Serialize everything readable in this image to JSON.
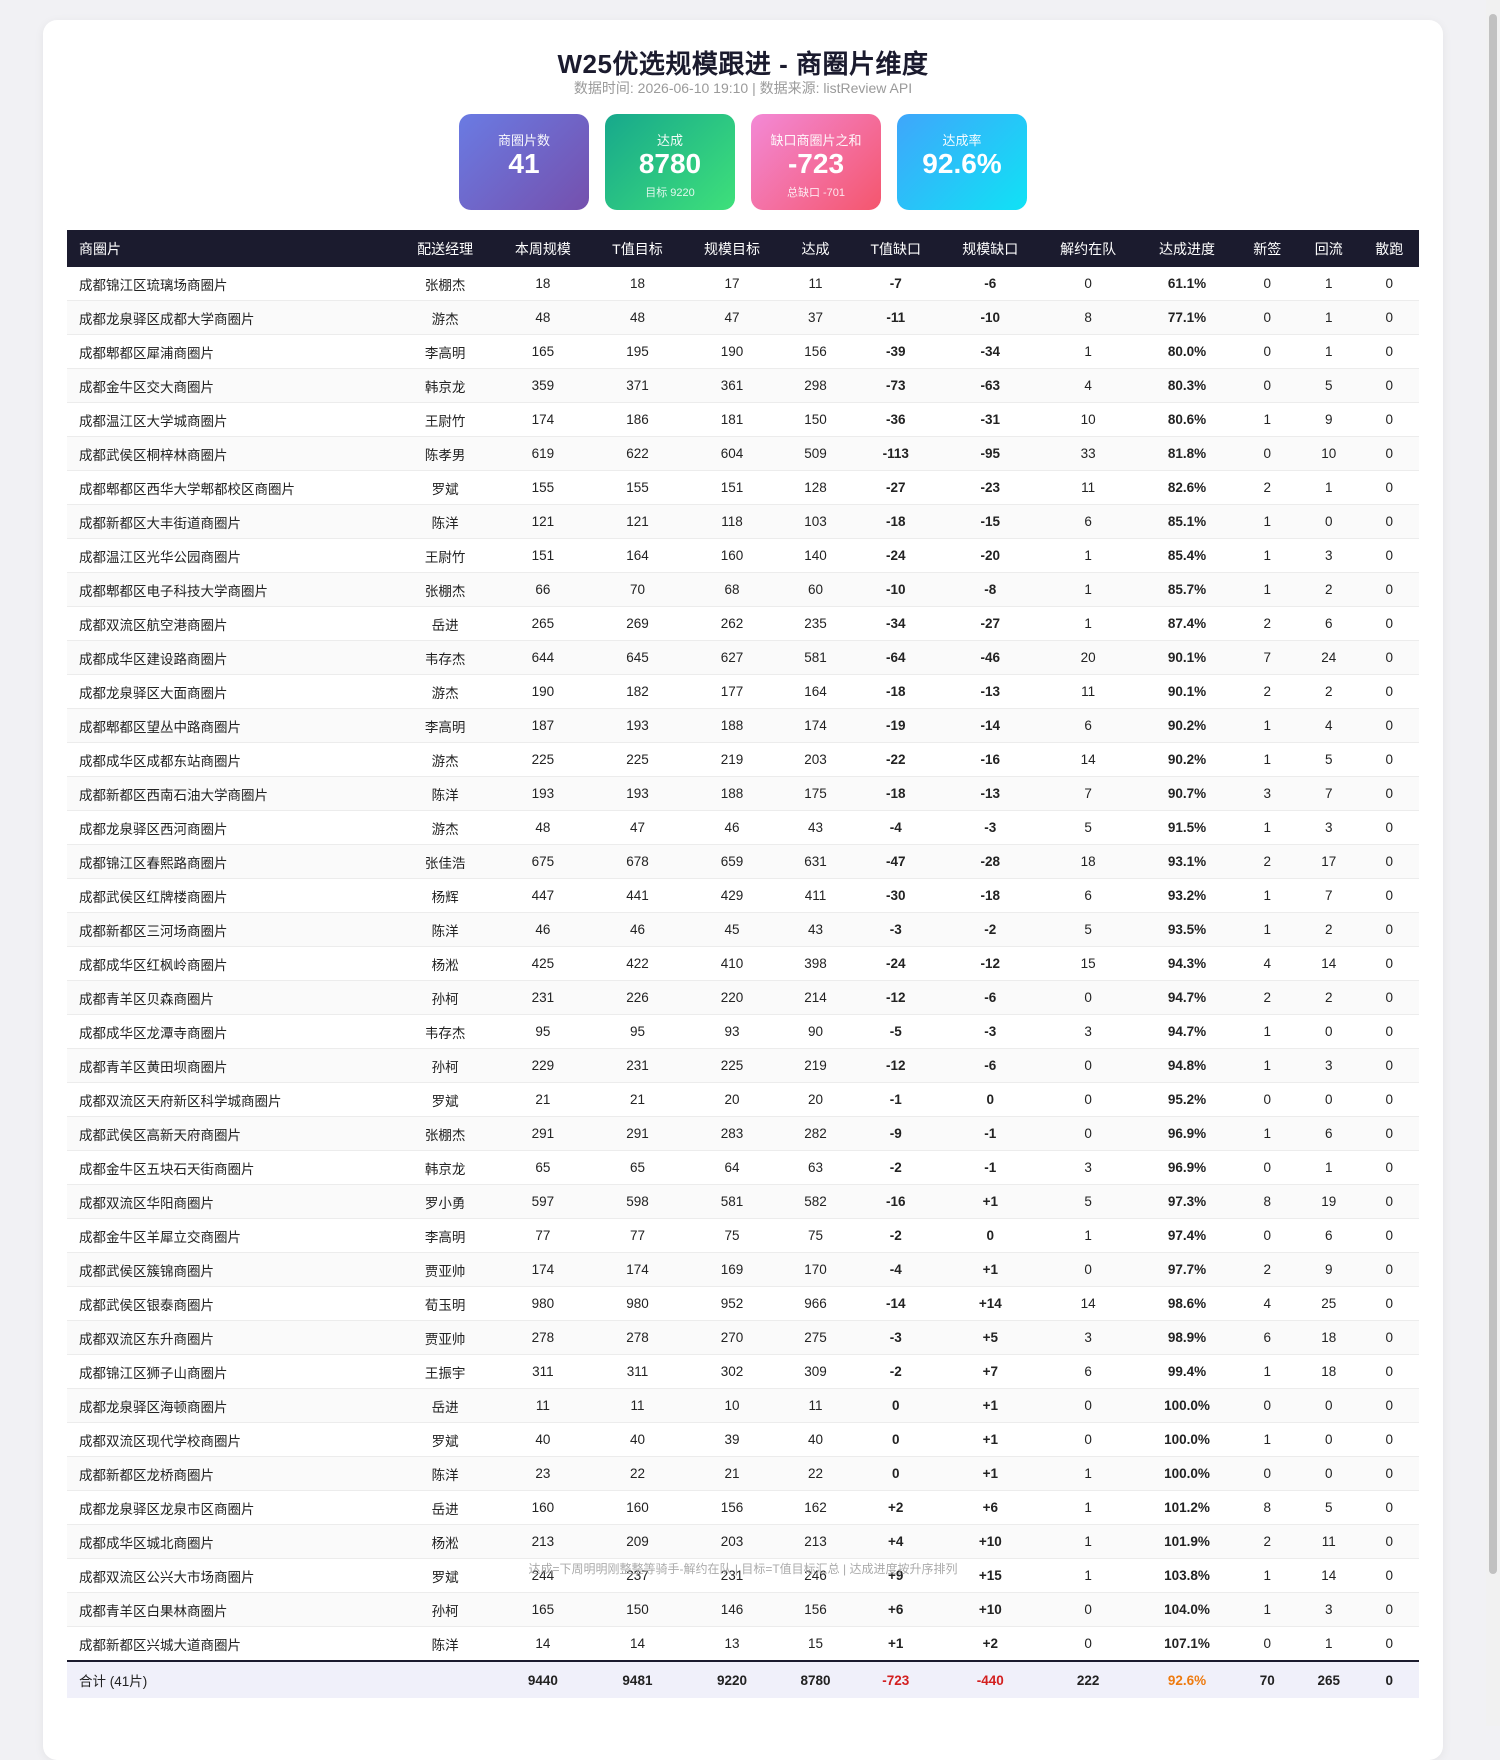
{
  "header": {
    "title": "W25优选规模跟进 - 商圈片维度",
    "subtitle": "数据时间: 2026-06-10 19:10 | 数据来源: listReview API"
  },
  "kpis": [
    {
      "label": "商圈片数",
      "value": "41",
      "sub": ""
    },
    {
      "label": "达成",
      "value": "8780",
      "sub": "目标 9220"
    },
    {
      "label": "缺口商圈片之和",
      "value": "-723",
      "sub": "总缺口 -701"
    },
    {
      "label": "达成率",
      "value": "92.6%",
      "sub": ""
    }
  ],
  "table": {
    "columns": [
      "商圈片",
      "配送经理",
      "本周规模",
      "T值目标",
      "规模目标",
      "达成",
      "T值缺口",
      "规模缺口",
      "解约在队",
      "达成进度",
      "新签",
      "回流",
      "散跑"
    ],
    "rows": [
      [
        "成都锦江区琉璃场商圈片",
        "张棚杰",
        "18",
        "18",
        "17",
        "11",
        "-7",
        "-6",
        "0",
        "61.1%",
        "0",
        "1",
        "0"
      ],
      [
        "成都龙泉驿区成都大学商圈片",
        "游杰",
        "48",
        "48",
        "47",
        "37",
        "-11",
        "-10",
        "8",
        "77.1%",
        "0",
        "1",
        "0"
      ],
      [
        "成都郫都区犀浦商圈片",
        "李高明",
        "165",
        "195",
        "190",
        "156",
        "-39",
        "-34",
        "1",
        "80.0%",
        "0",
        "1",
        "0"
      ],
      [
        "成都金牛区交大商圈片",
        "韩京龙",
        "359",
        "371",
        "361",
        "298",
        "-73",
        "-63",
        "4",
        "80.3%",
        "0",
        "5",
        "0"
      ],
      [
        "成都温江区大学城商圈片",
        "王尉竹",
        "174",
        "186",
        "181",
        "150",
        "-36",
        "-31",
        "10",
        "80.6%",
        "1",
        "9",
        "0"
      ],
      [
        "成都武侯区桐梓林商圈片",
        "陈孝男",
        "619",
        "622",
        "604",
        "509",
        "-113",
        "-95",
        "33",
        "81.8%",
        "0",
        "10",
        "0"
      ],
      [
        "成都郫都区西华大学郫都校区商圈片",
        "罗斌",
        "155",
        "155",
        "151",
        "128",
        "-27",
        "-23",
        "11",
        "82.6%",
        "2",
        "1",
        "0"
      ],
      [
        "成都新都区大丰街道商圈片",
        "陈洋",
        "121",
        "121",
        "118",
        "103",
        "-18",
        "-15",
        "6",
        "85.1%",
        "1",
        "0",
        "0"
      ],
      [
        "成都温江区光华公园商圈片",
        "王尉竹",
        "151",
        "164",
        "160",
        "140",
        "-24",
        "-20",
        "1",
        "85.4%",
        "1",
        "3",
        "0"
      ],
      [
        "成都郫都区电子科技大学商圈片",
        "张棚杰",
        "66",
        "70",
        "68",
        "60",
        "-10",
        "-8",
        "1",
        "85.7%",
        "1",
        "2",
        "0"
      ],
      [
        "成都双流区航空港商圈片",
        "岳进",
        "265",
        "269",
        "262",
        "235",
        "-34",
        "-27",
        "1",
        "87.4%",
        "2",
        "6",
        "0"
      ],
      [
        "成都成华区建设路商圈片",
        "韦存杰",
        "644",
        "645",
        "627",
        "581",
        "-64",
        "-46",
        "20",
        "90.1%",
        "7",
        "24",
        "0"
      ],
      [
        "成都龙泉驿区大面商圈片",
        "游杰",
        "190",
        "182",
        "177",
        "164",
        "-18",
        "-13",
        "11",
        "90.1%",
        "2",
        "2",
        "0"
      ],
      [
        "成都郫都区望丛中路商圈片",
        "李高明",
        "187",
        "193",
        "188",
        "174",
        "-19",
        "-14",
        "6",
        "90.2%",
        "1",
        "4",
        "0"
      ],
      [
        "成都成华区成都东站商圈片",
        "游杰",
        "225",
        "225",
        "219",
        "203",
        "-22",
        "-16",
        "14",
        "90.2%",
        "1",
        "5",
        "0"
      ],
      [
        "成都新都区西南石油大学商圈片",
        "陈洋",
        "193",
        "193",
        "188",
        "175",
        "-18",
        "-13",
        "7",
        "90.7%",
        "3",
        "7",
        "0"
      ],
      [
        "成都龙泉驿区西河商圈片",
        "游杰",
        "48",
        "47",
        "46",
        "43",
        "-4",
        "-3",
        "5",
        "91.5%",
        "1",
        "3",
        "0"
      ],
      [
        "成都锦江区春熙路商圈片",
        "张佳浩",
        "675",
        "678",
        "659",
        "631",
        "-47",
        "-28",
        "18",
        "93.1%",
        "2",
        "17",
        "0"
      ],
      [
        "成都武侯区红牌楼商圈片",
        "杨辉",
        "447",
        "441",
        "429",
        "411",
        "-30",
        "-18",
        "6",
        "93.2%",
        "1",
        "7",
        "0"
      ],
      [
        "成都新都区三河场商圈片",
        "陈洋",
        "46",
        "46",
        "45",
        "43",
        "-3",
        "-2",
        "5",
        "93.5%",
        "1",
        "2",
        "0"
      ],
      [
        "成都成华区红枫岭商圈片",
        "杨淞",
        "425",
        "422",
        "410",
        "398",
        "-24",
        "-12",
        "15",
        "94.3%",
        "4",
        "14",
        "0"
      ],
      [
        "成都青羊区贝森商圈片",
        "孙柯",
        "231",
        "226",
        "220",
        "214",
        "-12",
        "-6",
        "0",
        "94.7%",
        "2",
        "2",
        "0"
      ],
      [
        "成都成华区龙潭寺商圈片",
        "韦存杰",
        "95",
        "95",
        "93",
        "90",
        "-5",
        "-3",
        "3",
        "94.7%",
        "1",
        "0",
        "0"
      ],
      [
        "成都青羊区黄田坝商圈片",
        "孙柯",
        "229",
        "231",
        "225",
        "219",
        "-12",
        "-6",
        "0",
        "94.8%",
        "1",
        "3",
        "0"
      ],
      [
        "成都双流区天府新区科学城商圈片",
        "罗斌",
        "21",
        "21",
        "20",
        "20",
        "-1",
        "0",
        "0",
        "95.2%",
        "0",
        "0",
        "0"
      ],
      [
        "成都武侯区高新天府商圈片",
        "张棚杰",
        "291",
        "291",
        "283",
        "282",
        "-9",
        "-1",
        "0",
        "96.9%",
        "1",
        "6",
        "0"
      ],
      [
        "成都金牛区五块石天街商圈片",
        "韩京龙",
        "65",
        "65",
        "64",
        "63",
        "-2",
        "-1",
        "3",
        "96.9%",
        "0",
        "1",
        "0"
      ],
      [
        "成都双流区华阳商圈片",
        "罗小勇",
        "597",
        "598",
        "581",
        "582",
        "-16",
        "+1",
        "5",
        "97.3%",
        "8",
        "19",
        "0"
      ],
      [
        "成都金牛区羊犀立交商圈片",
        "李高明",
        "77",
        "77",
        "75",
        "75",
        "-2",
        "0",
        "1",
        "97.4%",
        "0",
        "6",
        "0"
      ],
      [
        "成都武侯区簇锦商圈片",
        "贾亚帅",
        "174",
        "174",
        "169",
        "170",
        "-4",
        "+1",
        "0",
        "97.7%",
        "2",
        "9",
        "0"
      ],
      [
        "成都武侯区银泰商圈片",
        "荀玉明",
        "980",
        "980",
        "952",
        "966",
        "-14",
        "+14",
        "14",
        "98.6%",
        "4",
        "25",
        "0"
      ],
      [
        "成都双流区东升商圈片",
        "贾亚帅",
        "278",
        "278",
        "270",
        "275",
        "-3",
        "+5",
        "3",
        "98.9%",
        "6",
        "18",
        "0"
      ],
      [
        "成都锦江区狮子山商圈片",
        "王振宇",
        "311",
        "311",
        "302",
        "309",
        "-2",
        "+7",
        "6",
        "99.4%",
        "1",
        "18",
        "0"
      ],
      [
        "成都龙泉驿区海顿商圈片",
        "岳进",
        "11",
        "11",
        "10",
        "11",
        "0",
        "+1",
        "0",
        "100.0%",
        "0",
        "0",
        "0"
      ],
      [
        "成都双流区现代学校商圈片",
        "罗斌",
        "40",
        "40",
        "39",
        "40",
        "0",
        "+1",
        "0",
        "100.0%",
        "1",
        "0",
        "0"
      ],
      [
        "成都新都区龙桥商圈片",
        "陈洋",
        "23",
        "22",
        "21",
        "22",
        "0",
        "+1",
        "1",
        "100.0%",
        "0",
        "0",
        "0"
      ],
      [
        "成都龙泉驿区龙泉市区商圈片",
        "岳进",
        "160",
        "160",
        "156",
        "162",
        "+2",
        "+6",
        "1",
        "101.2%",
        "8",
        "5",
        "0"
      ],
      [
        "成都成华区城北商圈片",
        "杨淞",
        "213",
        "209",
        "203",
        "213",
        "+4",
        "+10",
        "1",
        "101.9%",
        "2",
        "11",
        "0"
      ],
      [
        "成都双流区公兴大市场商圈片",
        "罗斌",
        "244",
        "237",
        "231",
        "246",
        "+9",
        "+15",
        "1",
        "103.8%",
        "1",
        "14",
        "0"
      ],
      [
        "成都青羊区白果林商圈片",
        "孙柯",
        "165",
        "150",
        "146",
        "156",
        "+6",
        "+10",
        "0",
        "104.0%",
        "1",
        "3",
        "0"
      ],
      [
        "成都新都区兴城大道商圈片",
        "陈洋",
        "14",
        "14",
        "13",
        "15",
        "+1",
        "+2",
        "0",
        "107.1%",
        "0",
        "1",
        "0"
      ]
    ],
    "total": [
      "合计 (41片)",
      "",
      "9440",
      "9481",
      "9220",
      "8780",
      "-723",
      "-440",
      "222",
      "92.6%",
      "70",
      "265",
      "0"
    ]
  },
  "footnote": "达成=下周明明刚整整等骑手-解约在队 | 目标=T值目标汇总 | 达成进度按升序排列",
  "colors": {
    "header_bg": "#1b1b2e",
    "negative": "#d32020",
    "positive": "#1c8a2e",
    "progress_low": "#cc1f1f",
    "progress_mid": "#ee7b10",
    "progress_high": "#1a63c4",
    "progress_done": "#1c8a2e"
  }
}
